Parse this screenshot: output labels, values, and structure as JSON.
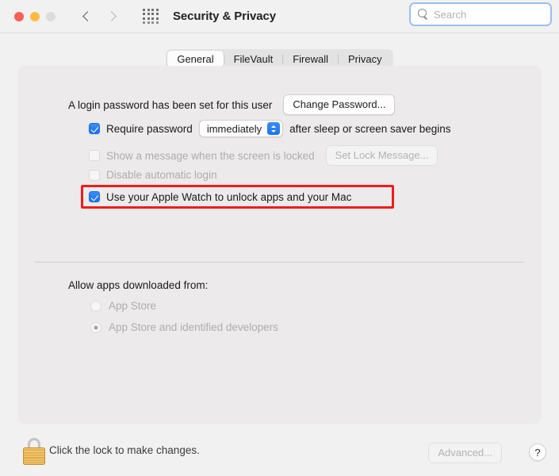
{
  "window": {
    "title": "Security & Privacy",
    "traffic_lights": [
      {
        "name": "close",
        "color": "#fc5d56"
      },
      {
        "name": "minimize",
        "color": "#fdbc40"
      },
      {
        "name": "zoom",
        "color": "#dcdcdc"
      }
    ],
    "nav": {
      "back_icon": "chevron-left-icon",
      "forward_icon": "chevron-right-icon"
    },
    "grid_icon": "show-all-grid-icon"
  },
  "search": {
    "icon": "search-icon",
    "placeholder": "Search",
    "value": "",
    "focused": true,
    "focus_ring_color": "#9cbdf0"
  },
  "tabs": [
    {
      "label": "General",
      "active": true
    },
    {
      "label": "FileVault",
      "active": false
    },
    {
      "label": "Firewall",
      "active": false
    },
    {
      "label": "Privacy",
      "active": false
    }
  ],
  "general": {
    "login_password": {
      "text": "A login password has been set for this user",
      "button_label": "Change Password..."
    },
    "require_password": {
      "checked": true,
      "label_before": "Require password",
      "popup_value": "immediately",
      "label_after": "after sleep or screen saver begins"
    },
    "show_message": {
      "checked": false,
      "enabled": false,
      "label": "Show a message when the screen is locked",
      "button_label": "Set Lock Message..."
    },
    "disable_auto_login": {
      "checked": false,
      "enabled": false,
      "label": "Disable automatic login"
    },
    "apple_watch": {
      "checked": true,
      "enabled": true,
      "label": "Use your Apple Watch to unlock apps and your Mac",
      "highlighted": true,
      "highlight_color": "#ee1c1c"
    },
    "allow_apps": {
      "heading": "Allow apps downloaded from:",
      "enabled": false,
      "options": [
        {
          "label": "App Store",
          "selected": false
        },
        {
          "label": "App Store and identified developers",
          "selected": true
        }
      ]
    }
  },
  "bottom_bar": {
    "lock_icon": "padlock-icon",
    "lock_text": "Click the lock to make changes.",
    "advanced_label": "Advanced...",
    "advanced_enabled": false,
    "help_label": "?"
  }
}
